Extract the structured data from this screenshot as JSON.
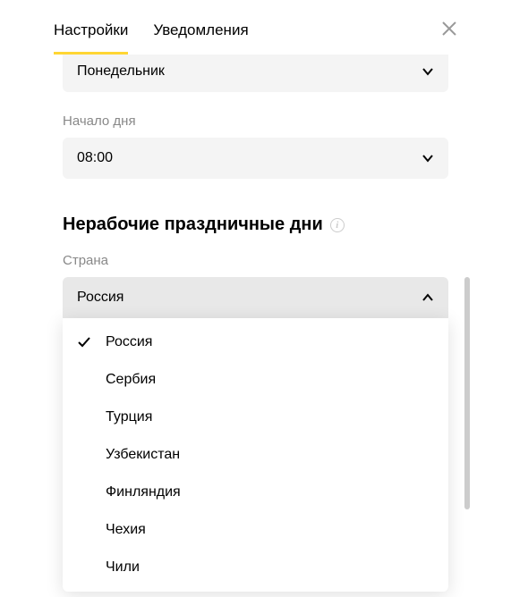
{
  "header": {
    "tabs": [
      {
        "label": "Настройки",
        "active": true
      },
      {
        "label": "Уведомления",
        "active": false
      }
    ]
  },
  "fields": {
    "weekday": {
      "value": "Понедельник"
    },
    "dayStart": {
      "label": "Начало дня",
      "value": "08:00"
    }
  },
  "holidays": {
    "title": "Нерабочие праздничные дни",
    "countryLabel": "Страна",
    "selectedCountry": "Россия",
    "options": [
      {
        "label": "Россия",
        "selected": true
      },
      {
        "label": "Сербия",
        "selected": false
      },
      {
        "label": "Турция",
        "selected": false
      },
      {
        "label": "Узбекистан",
        "selected": false
      },
      {
        "label": "Финляндия",
        "selected": false
      },
      {
        "label": "Чехия",
        "selected": false
      },
      {
        "label": "Чили",
        "selected": false
      }
    ]
  }
}
